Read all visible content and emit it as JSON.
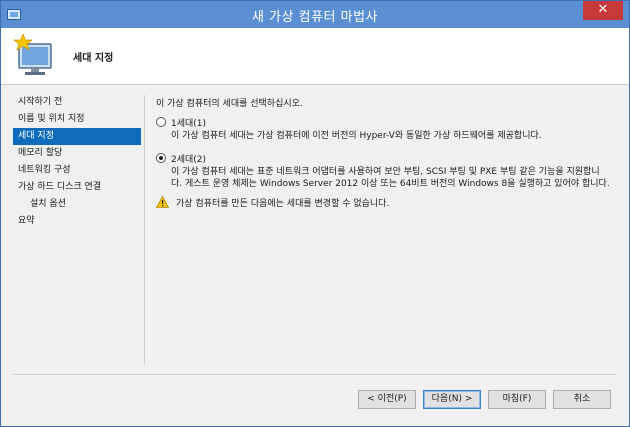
{
  "window": {
    "title": "새 가상 컴퓨터 마법사",
    "close_glyph": "✕"
  },
  "header": {
    "heading": "세대 지정"
  },
  "sidebar": {
    "items": [
      {
        "label": "시작하기 전",
        "active": false,
        "sub": false
      },
      {
        "label": "이름 및 위치 지정",
        "active": false,
        "sub": false
      },
      {
        "label": "세대 지정",
        "active": true,
        "sub": false
      },
      {
        "label": "메모리 할당",
        "active": false,
        "sub": false
      },
      {
        "label": "네트워킹 구성",
        "active": false,
        "sub": false
      },
      {
        "label": "가상 하드 디스크 연결",
        "active": false,
        "sub": false
      },
      {
        "label": "설치 옵션",
        "active": false,
        "sub": true
      },
      {
        "label": "요약",
        "active": false,
        "sub": false
      }
    ]
  },
  "main": {
    "intro": "이 가상 컴퓨터의 세대를 선택하십시오.",
    "gen1": {
      "label": "1세대(1)",
      "checked": false,
      "desc_lines": [
        "이 가상 컴퓨터 세대는 가상 컴퓨터에 이전 버전의 Hyper-V와 동일한 가상 하드웨어를 제공합니다."
      ]
    },
    "gen2": {
      "label": "2세대(2)",
      "checked": true,
      "desc_lines": [
        "이 가상 컴퓨터 세대는 표준 네트워크 어댑터를 사용하여 보안 부팅, SCSI 부팅 및 PXE 부팅 같은 기능을 지원합니",
        "다. 게스트 운영 체제는 Windows Server 2012 이상 또는 64비트 버전의 Windows 8을 실행하고 있어야 합니다."
      ]
    },
    "warning": "가상 컴퓨터를 만든 다음에는 세대를 변경할 수 없습니다."
  },
  "buttons": {
    "prev": "< 이전(P)",
    "next": "다음(N) >",
    "finish": "마침(F)",
    "cancel": "취소"
  },
  "icons": {
    "app": "hyperv-window-icon",
    "wizard": "monitor-star-icon",
    "warning": "warning-triangle-icon"
  },
  "colors": {
    "titlebar": "#5b8fd3",
    "close": "#c7383a",
    "active_nav": "#0f6cbd"
  }
}
